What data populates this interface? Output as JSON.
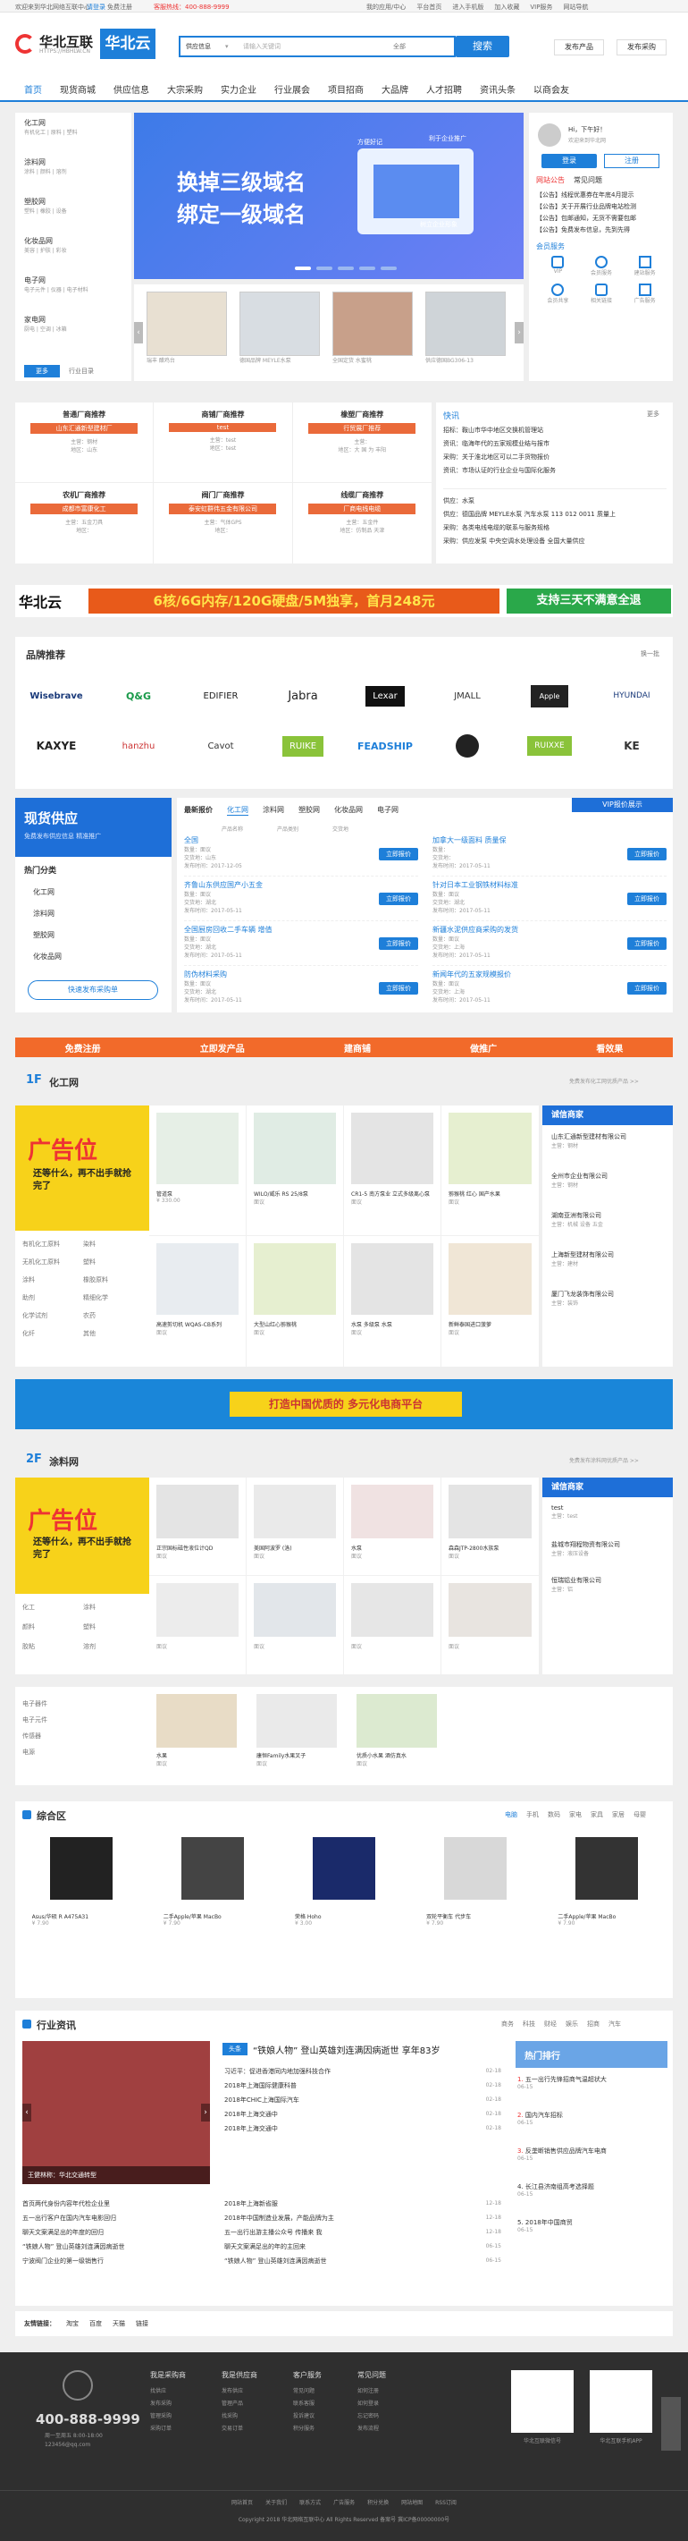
{
  "topbar": {
    "left": "欢迎来到华北网络互联中心",
    "login": "请登录",
    "register": "免费注册",
    "hotline": "客服热线：400-888-9999",
    "links": [
      "我的应用/中心",
      "平台首页",
      "进入手机版",
      "加入收藏",
      "VIP服务",
      "网站导航"
    ]
  },
  "header": {
    "logo_text": "华北互联",
    "logo_sub": "HTTPS://HBHLW.CN",
    "logo2": "华北云",
    "search_select": "供应信息",
    "search_placeholder": "请输入关键词",
    "search_tag": "全部",
    "search_btn": "搜索",
    "btn_publish_product": "发布产品",
    "btn_publish_buy": "发布采购",
    "hot": "热门搜索："
  },
  "nav": [
    "首页",
    "现货商城",
    "供应信息",
    "大宗采购",
    "实力企业",
    "行业展会",
    "项目招商",
    "大品牌",
    "人才招聘",
    "资讯头条",
    "以商会友"
  ],
  "categories": [
    {
      "t": "化工网",
      "s": "有机化工 | 原料 | 塑料"
    },
    {
      "t": "涂料网",
      "s": "涂料 | 颜料 | 溶剂"
    },
    {
      "t": "塑胶网",
      "s": "塑料 | 橡胶 | 设备"
    },
    {
      "t": "化妆品网",
      "s": "美容 | 护肤 | 彩妆"
    },
    {
      "t": "电子网",
      "s": "电子元件 | 仪器 | 电子材料"
    },
    {
      "t": "家电网",
      "s": "厨电 | 空调 | 冰箱"
    }
  ],
  "cat_more": "更多",
  "cat_more2": "行业目录",
  "banner": {
    "line1": "换掉三级域名",
    "line2": "绑定一级域名",
    "tag": "方便好记",
    "tag2": "利于企业推广",
    "tag3": "树立企业形象"
  },
  "userbox": {
    "hello": "Hi，下午好！",
    "welcome": "欢迎来到华北网",
    "login": "登录",
    "register": "注册",
    "tabs": [
      "网站公告",
      "常见问题"
    ],
    "notices": [
      "【公告】线程优惠券在年底4月提示",
      "【公告】关于开展行业品牌电站检测",
      "【公告】包邮通知，无货不需要包邮",
      "【公告】免费发布信息，先到先得"
    ],
    "svc_title": "会员服务",
    "services": [
      "VIP",
      "会员服务",
      "建站服务",
      "会员共享",
      "相关链接",
      "广告服务"
    ]
  },
  "products": [
    "瑞丰 醋鸡台",
    "德国品牌 MEYLE水泵",
    "全国定货 水蜜桃",
    "供应德国BG306-13"
  ],
  "recs": [
    {
      "t": "普通厂商推荐",
      "a": "山东汇通新型建材厂",
      "c": "主营：钢材",
      "l": "地区：山东"
    },
    {
      "t": "商铺厂商推荐",
      "a": "test",
      "c": "主营：test",
      "l": "地区：test"
    },
    {
      "t": "橡塑厂商推荐",
      "a": "行贸展厂推荐",
      "c": "主营：",
      "l": "地区：大 国 为 丰阳"
    },
    {
      "t": "农机厂商推荐",
      "a": "成都市富康化工",
      "c": "主营：五金刀具",
      "l": "地区："
    },
    {
      "t": "阀门厂商推荐",
      "a": "泰安虹群伟五金有限公司",
      "c": "主营：气体GPS",
      "l": "地区："
    },
    {
      "t": "线缆厂商推荐",
      "a": "厂商电线电缆",
      "c": "主营：五金件",
      "l": "地区：仿制品 天津"
    }
  ],
  "flash": {
    "title": "快讯",
    "more": "更多",
    "items": [
      "招标：鞍山市华中地区交换机管理站",
      "资讯：临海年代的五家规模业结与报市",
      "采购：关于淮北地区可以二手货物报价",
      "资讯：市场认证的行业企业与国际化服务"
    ],
    "items2": [
      "供应：水泵",
      "供应：德国品牌 MEYLE水泵 汽车水泵 113 012 0011 质量上",
      "采购：各类电线电缆的联系与服务规格",
      "采购：供应发泵 中央空调水处理设备 全国大量供应"
    ]
  },
  "adbar": {
    "logo": "华北云",
    "text": "6核/6G内存/120G硬盘/5M独享，首月248元",
    "cta": "支持三天不满意全退"
  },
  "brands": {
    "title": "品牌推荐",
    "more": "换一批",
    "names": [
      "Wisebrave",
      "Q&G",
      "EDIFIER",
      "Jabra",
      "Lexar",
      "JMALL",
      "Apple",
      "HYUNDAI",
      "KAXYE",
      "hanzhu",
      "Cavot",
      "RUIKE",
      "FEADSHIP",
      "",
      "RUIXXE",
      "KE"
    ]
  },
  "supply": {
    "title": "现货供应",
    "sub": "免费发布供应信息 精准推广",
    "hot": "热门分类",
    "cats": [
      "化工网",
      "涂料网",
      "塑胶网",
      "化妆品网"
    ],
    "btn": "快速发布采购单",
    "tabs": [
      "最新报价",
      "化工网",
      "涂料网",
      "塑胶网",
      "化妆品网",
      "电子网"
    ],
    "vip": "VIP报价展示",
    "cols": [
      "产品名称",
      "产品类别",
      "交货地"
    ],
    "items": [
      {
        "name": "全国",
        "qty": "数量：面议",
        "loc": "交货地：山东",
        "time": "发布时间：2017-12-05",
        "btn": "立即报价"
      },
      {
        "name": "加拿大一级面料 质量保",
        "qty": "数量：",
        "loc": "交货地：",
        "time": "发布时间：2017-05-11",
        "btn": "立即报价"
      },
      {
        "name": "齐鲁山东供应国产小五金",
        "qty": "数量：面议",
        "loc": "交货地：湖北",
        "time": "发布时间：2017-05-11",
        "btn": "立即报价"
      },
      {
        "name": "针对日本工业钢铁材料标准",
        "qty": "数量：面议",
        "loc": "交货地：湖北",
        "time": "发布时间：2017-05-11",
        "btn": "立即报价"
      },
      {
        "name": "全国厨房回收二手车辆 增值",
        "qty": "数量：面议",
        "loc": "交货地：湖北",
        "time": "发布时间：2017-05-11",
        "btn": "立即报价"
      },
      {
        "name": "新疆水泥供应商采购的发货",
        "qty": "数量：面议",
        "loc": "交货地：上海",
        "time": "发布时间：2017-05-11",
        "btn": "立即报价"
      },
      {
        "name": "防伪材料采购",
        "qty": "数量：面议",
        "loc": "交货地：湖北",
        "time": "发布时间：2017-05-11",
        "btn": "立即报价"
      },
      {
        "name": "新闻年代的五家规模报价",
        "qty": "数量：面议",
        "loc": "交货地：上海",
        "time": "发布时间：2017-05-11",
        "btn": "立即报价"
      }
    ]
  },
  "orange_bar": [
    "免费注册",
    "立即发产品",
    "建商铺",
    "做推广",
    "看效果"
  ],
  "floor1": {
    "num": "1F",
    "name": "化工网",
    "more": "免费发布化工网优质产品 >>",
    "ad": "广告位",
    "ad_sub": "还等什么，再不出手就抢完了",
    "prods": [
      {
        "n": "管道泵",
        "p": "¥ 330.00",
        "b": "面议"
      },
      {
        "n": "WILO/威乐 RS 25/8泵",
        "p": "面议",
        "b": "面议"
      },
      {
        "n": "CR1-5 南方泵业 立式多级离心泵",
        "p": "面议",
        "b": "面议"
      },
      {
        "n": "猕猴桃 红心 国产水果",
        "p": "面议",
        "b": "面议"
      },
      {
        "n": "高速剪切机 WQAS-CB系列",
        "p": "面议",
        "b": "面议"
      },
      {
        "n": "大型山红心猕猴桃",
        "p": "面议",
        "b": "面议"
      },
      {
        "n": "水泵 多级泵 水泵",
        "p": "面议",
        "b": "面议"
      },
      {
        "n": "新鲜泰国进口菠萝",
        "p": "面议",
        "b": "面议"
      }
    ],
    "tags": [
      "有机化工原料",
      "染料",
      "无机化工原料",
      "塑料",
      "涂料",
      "橡胶原料",
      "助剂",
      "精细化学",
      "化学试剂",
      "农药",
      "化纤",
      "其他"
    ],
    "biz_title": "诚信商家",
    "biz": [
      {
        "n": "山东汇通新型建材有限公司",
        "s": "主营：钢材"
      },
      {
        "n": "全州市企业有限公司",
        "s": "主营：钢材"
      },
      {
        "n": "湖南亚洲有限公司",
        "s": "主营：机械 设备 五金"
      },
      {
        "n": "上海新型建材有限公司",
        "s": "主营：建材"
      },
      {
        "n": "厦门飞龙装饰有限公司",
        "s": "主营：装饰"
      }
    ]
  },
  "green_banner": "打造中国优质的  多元化电商平台",
  "floor2": {
    "num": "2F",
    "name": "涂料网",
    "more": "免费发布涂料网优质产品 >>",
    "prods": [
      {
        "n": "正宗国标磁性液位计QD",
        "b": "面议"
      },
      {
        "n": "美国阿波罗 (洛)",
        "b": "面议"
      },
      {
        "n": "水泵",
        "b": "面议"
      },
      {
        "n": "森森JTP-2800水族泵",
        "b": "面议"
      },
      {
        "n": "",
        "b": "面议"
      },
      {
        "n": "",
        "b": "面议"
      },
      {
        "n": "",
        "b": "面议"
      },
      {
        "n": "",
        "b": "面议"
      }
    ],
    "tags": [
      "化工",
      "涂料",
      "颜料",
      "塑料",
      "胶粘",
      "溶剂"
    ],
    "biz": [
      {
        "n": "test",
        "s": "主营：test"
      },
      {
        "n": "盐城市翔程物资有限公司",
        "s": "主营：液压设备"
      },
      {
        "n": "恒瑞铝业有限公司",
        "s": "主营：铝"
      }
    ]
  },
  "floor3": {
    "prods": [
      {
        "n": "水果",
        "b": "面议"
      },
      {
        "n": "康恒Family水果叉子",
        "b": "面议"
      },
      {
        "n": "优质小水果 酒仿真水",
        "b": "面议"
      }
    ],
    "tags": [
      "电子器件",
      "电子元件",
      "传感器",
      "电源"
    ]
  },
  "general": {
    "title": "综合区",
    "tabs": [
      "电脑",
      "手机",
      "数码",
      "家电",
      "家具",
      "家居",
      "母婴"
    ],
    "prods": [
      {
        "n": "Asus/华硕 R A475A31",
        "p": "¥ 7.90"
      },
      {
        "n": "二手Apple/苹果 MacBo",
        "p": "¥ 7.90"
      },
      {
        "n": "荣格 Hoho",
        "p": "¥ 3.00"
      },
      {
        "n": "双轮平衡车 代步车",
        "p": "¥ 7.90"
      },
      {
        "n": "二手Apple/苹果 MacBo",
        "p": "¥ 7.90"
      }
    ]
  },
  "news": {
    "title": "行业资讯",
    "tabs": [
      "商务",
      "科技",
      "财经",
      "娱乐",
      "招商",
      "汽车"
    ],
    "cap": "王健林称：华北交通转型",
    "headline": "“铁娘人物”  登山英雄刘连满因病逝世 享年83岁",
    "badge": "头条",
    "list1": [
      {
        "t": "习近平：促进香港同内地加强科技合作",
        "d": "02-18"
      },
      {
        "t": "2018年上海国际健康科普",
        "d": "02-18"
      },
      {
        "t": "2018年CHIC上海国际汽车",
        "d": "02-18"
      },
      {
        "t": "2018年上海交通中",
        "d": "02-18"
      },
      {
        "t": "2018年上海交通中",
        "d": "02-18"
      }
    ],
    "list2": [
      {
        "t": "首页两代身份内容年代检企业里",
        "d": ""
      },
      {
        "t": "五一出行客户在国内汽车电影回归",
        "d": ""
      },
      {
        "t": "聊天文案满足出的年度的回归",
        "d": ""
      },
      {
        "t": "“铁娘人物” 登山英雄刘连满因病逝世",
        "d": ""
      },
      {
        "t": "宁波阀门企业的第一级销售行",
        "d": ""
      }
    ],
    "list3": [
      {
        "t": "2018年上海新省服",
        "d": "12-18"
      },
      {
        "t": "2018年中国制造业发展，产能品牌为主",
        "d": "12-18"
      },
      {
        "t": "五一出行出游主播公众号 传播来 我",
        "d": "12-18"
      },
      {
        "t": "聊天文案满足出的年的主回来",
        "d": "06-15"
      },
      {
        "t": "“铁娘人物” 登山英雄刘连满因病逝世",
        "d": "06-15"
      }
    ],
    "rank_title": "热门排行",
    "rank": [
      {
        "t": "五一出行先锋招商气温超状大",
        "d": "06-15"
      },
      {
        "t": "国内汽车招标",
        "d": "06-15"
      },
      {
        "t": "反垄断销售供应品牌汽车电商",
        "d": "06-15"
      },
      {
        "t": "长江县济南组高考选择题",
        "d": "06-15"
      },
      {
        "t": "2018年中国商贸",
        "d": "06-15"
      }
    ]
  },
  "links": {
    "title": "友情链接：",
    "items": [
      "淘宝",
      "百度",
      "天猫",
      "链接"
    ]
  },
  "footer": {
    "phone": "400-888-9999",
    "time": "周一至周五 8:00-18:00",
    "email": "123456@qq.com",
    "cols": [
      {
        "t": "我是采购商",
        "items": [
          "找供应",
          "发布采购",
          "管理采购",
          "采购订单"
        ]
      },
      {
        "t": "我是供应商",
        "items": [
          "发布供应",
          "管理产品",
          "找采购",
          "交易订单"
        ]
      },
      {
        "t": "客户服务",
        "items": [
          "常见问题",
          "联系客服",
          "投诉建议",
          "积分服务"
        ]
      },
      {
        "t": "常见问题",
        "items": [
          "如何注册",
          "如何登录",
          "忘记密码",
          "发布流程"
        ]
      }
    ],
    "qr1": "华北互联微信号",
    "qr2": "华北互联手机APP",
    "links": [
      "网站首页",
      "关于我们",
      "联系方式",
      "广告服务",
      "积分兑换",
      "网站地图",
      "RSS订阅"
    ],
    "copy": "Copyright 2018 华北网络互联中心 All Rights Reserved 备案号",
    "copy2": "冀ICP备00000000号"
  }
}
